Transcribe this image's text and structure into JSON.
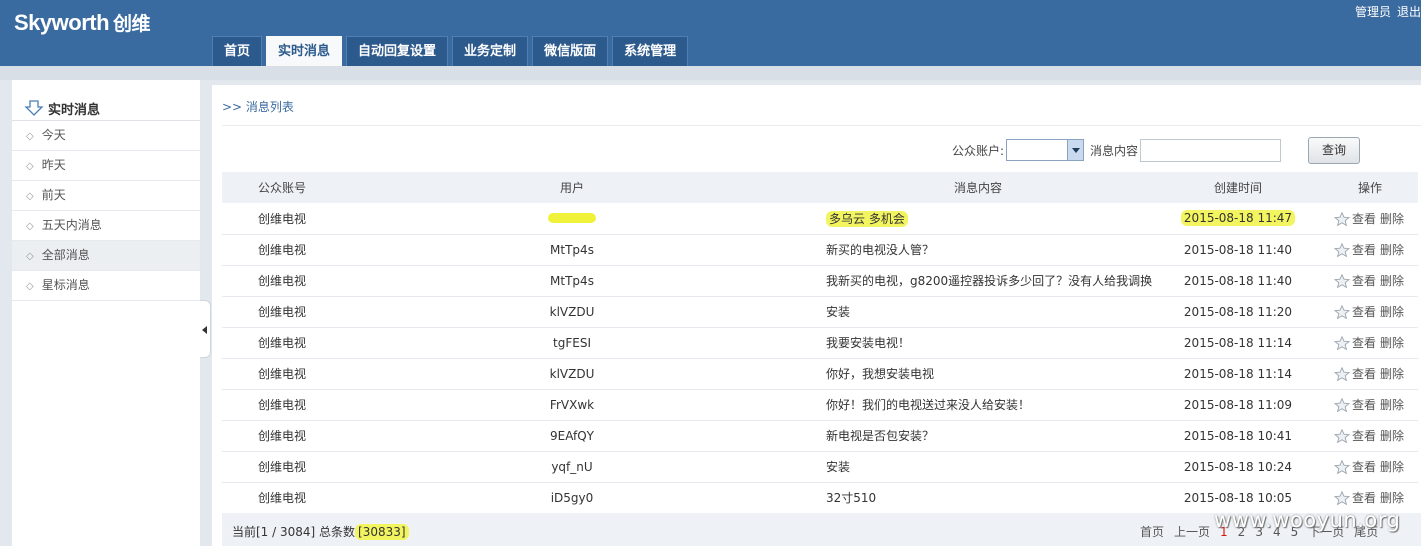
{
  "header": {
    "logo": "Skyworth",
    "logo_cn": "创维",
    "user_role": "管理员",
    "logout": "退出"
  },
  "nav": {
    "tabs": [
      {
        "label": "首页",
        "active": false
      },
      {
        "label": "实时消息",
        "active": true
      },
      {
        "label": "自动回复设置",
        "active": false
      },
      {
        "label": "业务定制",
        "active": false
      },
      {
        "label": "微信版面",
        "active": false
      },
      {
        "label": "系统管理",
        "active": false
      }
    ]
  },
  "sidebar": {
    "title": "实时消息",
    "items": [
      {
        "label": "今天",
        "active": false
      },
      {
        "label": "昨天",
        "active": false
      },
      {
        "label": "前天",
        "active": false
      },
      {
        "label": "五天内消息",
        "active": false
      },
      {
        "label": "全部消息",
        "active": true
      },
      {
        "label": "星标消息",
        "active": false
      }
    ]
  },
  "main": {
    "breadcrumb": ">> 消息列表",
    "search": {
      "account_label": "公众账户:",
      "account_value": "",
      "content_label": "消息内容",
      "content_value": "",
      "query_button": "查询"
    },
    "table": {
      "headers": [
        "公众账号",
        "用户",
        "消息内容",
        "创建时间",
        "操作"
      ],
      "rows": [
        {
          "account": "创维电视",
          "user": "",
          "message": "多乌云 多机会",
          "time": "2015-08-18 11:47"
        },
        {
          "account": "创维电视",
          "user": "MtTp4s",
          "message": "新买的电视没人管？",
          "time": "2015-08-18 11:40"
        },
        {
          "account": "创维电视",
          "user": "MtTp4s",
          "message": "我新买的电视，g8200遥控器投诉多少回了？没有人给我调换",
          "time": "2015-08-18 11:40"
        },
        {
          "account": "创维电视",
          "user": "klVZDU",
          "message": "安装",
          "time": "2015-08-18 11:20"
        },
        {
          "account": "创维电视",
          "user": "tgFESI",
          "message": "我要安装电视！",
          "time": "2015-08-18 11:14"
        },
        {
          "account": "创维电视",
          "user": "klVZDU",
          "message": "你好，我想安装电视",
          "time": "2015-08-18 11:14"
        },
        {
          "account": "创维电视",
          "user": "FrVXwk",
          "message": "你好！我们的电视送过来没人给安装！",
          "time": "2015-08-18 11:09"
        },
        {
          "account": "创维电视",
          "user": "9EAfQY",
          "message": "新电视是否包安装？",
          "time": "2015-08-18 10:41"
        },
        {
          "account": "创维电视",
          "user": "yqf_nU",
          "message": "安装",
          "time": "2015-08-18 10:24"
        },
        {
          "account": "创维电视",
          "user": "iD5gy0",
          "message": "32寸510",
          "time": "2015-08-18 10:05"
        }
      ],
      "op_view": "查看",
      "op_delete": "删除"
    },
    "footer": {
      "count_prefix": "当前[1 / 3084] 总条数",
      "count_total": "[30833]",
      "pager": {
        "first": "首页",
        "prev": "上一页",
        "pages": [
          "1",
          "2",
          "3",
          "4",
          "5"
        ],
        "current": "1",
        "next": "下一页",
        "last": "尾页"
      }
    }
  },
  "watermark": "www.wooyun.org",
  "colors": {
    "header_bg": "#3a6ba0",
    "tab_bg": "#2d5a8c",
    "highlight": "#f3f560"
  }
}
